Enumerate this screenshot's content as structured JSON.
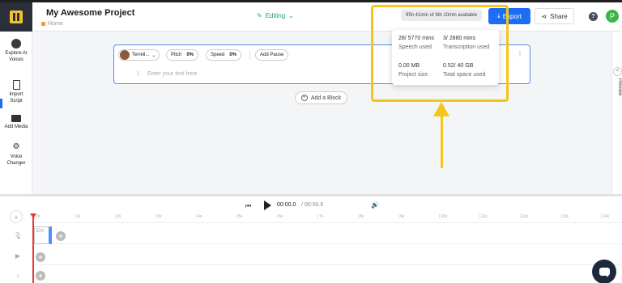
{
  "header": {
    "project_title": "My Awesome Project",
    "breadcrumb": "Home",
    "status": "Editing",
    "usage_pill": "95h 41min of 9th 10min available",
    "export_label": "Export",
    "share_label": "Share",
    "help_glyph": "?",
    "avatar_initial": "P"
  },
  "sidebar": {
    "items": [
      {
        "label_1": "Explore AI",
        "label_2": "Voices"
      },
      {
        "label_1": "Import",
        "label_2": "Script"
      },
      {
        "label_1": "Add Media",
        "label_2": ""
      },
      {
        "label_1": "Voice",
        "label_2": "Changer"
      }
    ]
  },
  "preview": {
    "label": "Preview",
    "chevron": "<"
  },
  "block": {
    "voice_name": "Terrell...",
    "pitch_label": "Pitch",
    "pitch_value": "0%",
    "speed_label": "Speed",
    "speed_value": "0%",
    "add_pause_label": "Add Pause",
    "text_placeholder": "Enter your text here",
    "more_glyph": "⋮"
  },
  "add_block_label": "Add a Block",
  "usage_popover": {
    "speech_value": "28/ 5770 mins",
    "speech_label": "Speech used",
    "transcription_value": "3/ 2880 mins",
    "transcription_label": "Transcription used",
    "project_size_value": "0.00 MB",
    "project_size_label": "Project size",
    "total_space_value": "0.52/ 40 GB",
    "total_space_label": "Total space used"
  },
  "timeline": {
    "current_time": "00:00.0",
    "total_time": "/ 00:00.5",
    "ruler_ticks": [
      "0s",
      "1s",
      "2s",
      "3s",
      "4s",
      "5s",
      "6s",
      "7s",
      "8s",
      "9s",
      "10s",
      "11s",
      "12s",
      "13s",
      "14s"
    ],
    "clip_text": "Ent"
  },
  "colors": {
    "accent": "#1e6ef5",
    "status": "#1da462",
    "highlight": "#f5c518",
    "playhead": "#e53935"
  }
}
